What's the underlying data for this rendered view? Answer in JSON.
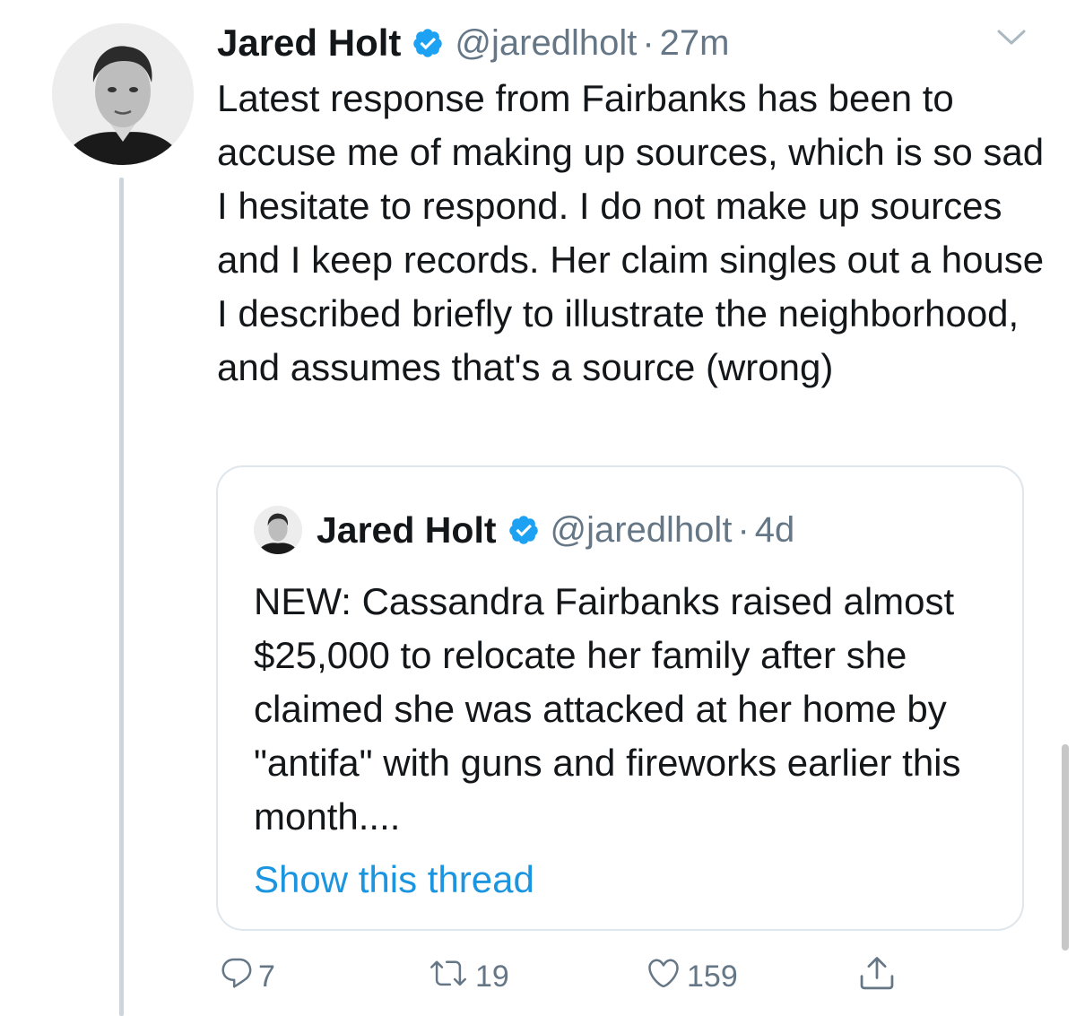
{
  "tweet": {
    "author_name": "Jared Holt",
    "handle": "@jaredlholt",
    "separator": "·",
    "time": "27m",
    "text": "Latest response from Fairbanks has been to accuse me of making up sources, which is so sad I hesitate to respond. I do not make up sources and I keep records. Her claim singles out a house I described briefly to illustrate the neighborhood, and assumes that's a source (wrong)"
  },
  "quoted_tweet": {
    "author_name": "Jared Holt",
    "handle": "@jaredlholt",
    "separator": "·",
    "time": "4d",
    "text": "NEW: Cassandra Fairbanks raised almost $25,000 to relocate her family after she claimed she was attacked at her home by \"antifa\" with guns and fireworks earlier this month....",
    "show_thread_label": "Show this thread"
  },
  "actions": {
    "replies": "7",
    "retweets": "19",
    "likes": "159"
  },
  "icons": {
    "verified": "verified-badge-icon",
    "caret": "chevron-down-icon",
    "reply": "reply-icon",
    "retweet": "retweet-icon",
    "like": "heart-icon",
    "share": "share-icon"
  },
  "colors": {
    "text": "#14171a",
    "muted": "#657786",
    "link": "#1b95e0",
    "verified": "#1da1f2",
    "border": "#dfe6ec",
    "thread_line": "#ccd6dd"
  }
}
